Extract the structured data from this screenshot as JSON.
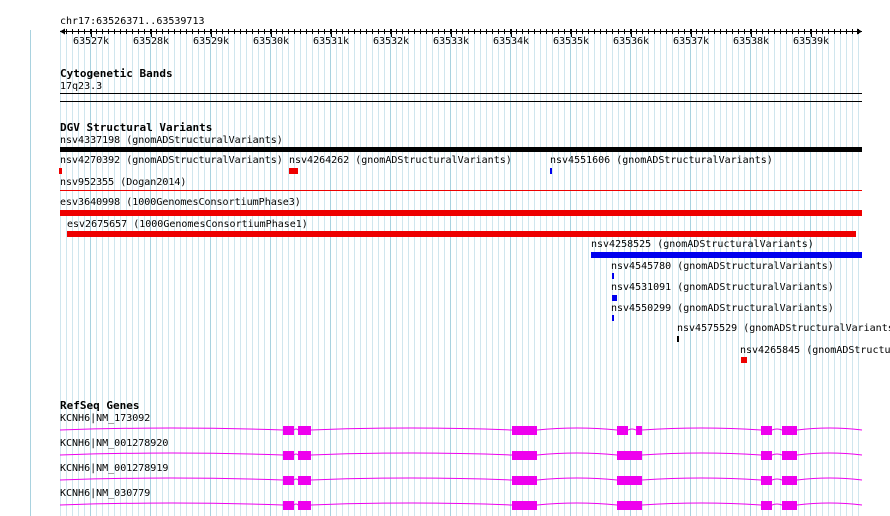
{
  "location": "chr17:63526371..63539713",
  "ruler": {
    "ticks": [
      "63527k",
      "63528k",
      "63529k",
      "63530k",
      "63531k",
      "63532k",
      "63533k",
      "63534k",
      "63535k",
      "63536k",
      "63537k",
      "63538k",
      "63539k"
    ]
  },
  "tracks": {
    "cytoband": {
      "title": "Cytogenetic Bands",
      "band": "17q23.3"
    },
    "dgv": {
      "title": "DGV Structural Variants",
      "features": [
        {
          "label": "nsv4337198 (gnomADStructuralVariants)",
          "color": "#000000"
        },
        {
          "label": "nsv4270392 (gnomADStructuralVariants)",
          "color": "#ee0000"
        },
        {
          "label": "nsv4264262 (gnomADStructuralVariants)",
          "color": "#ee0000"
        },
        {
          "label": "nsv4551606 (gnomADStructuralVariants)",
          "color": "#0000ee"
        },
        {
          "label": "nsv952355 (Dogan2014)",
          "color": "#ee0000"
        },
        {
          "label": "esv3640998 (1000GenomesConsortiumPhase3)",
          "color": "#ee0000"
        },
        {
          "label": "esv2675657 (1000GenomesConsortiumPhase1)",
          "color": "#ee0000"
        },
        {
          "label": "nsv4258525 (gnomADStructuralVariants)",
          "color": "#0000ee"
        },
        {
          "label": "nsv4545780 (gnomADStructuralVariants)",
          "color": "#0000ee"
        },
        {
          "label": "nsv4531091 (gnomADStructuralVariants)",
          "color": "#0000ee"
        },
        {
          "label": "nsv4550299 (gnomADStructuralVariants)",
          "color": "#0000ee"
        },
        {
          "label": "nsv4575529 (gnomADStructuralVariants",
          "color": "#000000"
        },
        {
          "label": "nsv4265845 (gnomADStructu",
          "color": "#ee0000"
        }
      ]
    },
    "refseq": {
      "title": "RefSeq Genes",
      "color": "#ee00ee",
      "transcripts": [
        {
          "label": "KCNH6|NM_173092"
        },
        {
          "label": "KCNH6|NM_001278920"
        },
        {
          "label": "KCNH6|NM_001278919"
        },
        {
          "label": "KCNH6|NM_030779"
        }
      ]
    }
  }
}
